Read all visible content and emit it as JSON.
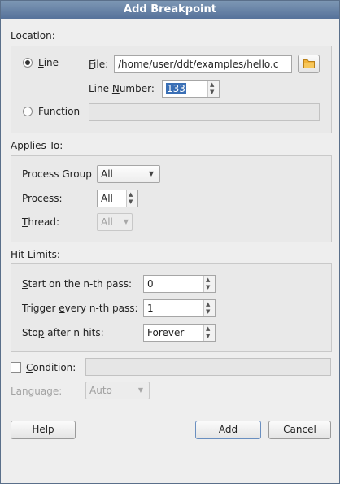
{
  "window": {
    "title": "Add Breakpoint"
  },
  "location": {
    "label": "Location:",
    "line_option": {
      "pre": "",
      "mnemonic": "L",
      "post": "ine",
      "checked": true
    },
    "file": {
      "pre": "",
      "mnemonic": "F",
      "post": "ile:",
      "value": "/home/user/ddt/examples/hello.c"
    },
    "folder_icon": "folder-icon",
    "line_number": {
      "pre": "Line ",
      "mnemonic": "N",
      "post": "umber:",
      "value": "133"
    },
    "function_option": {
      "pre": "F",
      "mnemonic": "u",
      "post": "nction",
      "checked": false,
      "value": ""
    }
  },
  "applies_to": {
    "label": "Applies To:",
    "process_group": {
      "label": "Process Group",
      "value": "All"
    },
    "process": {
      "label": "Process:",
      "value": "All"
    },
    "thread": {
      "pre": "",
      "mnemonic": "T",
      "post": "hread:",
      "value": "All",
      "enabled": false
    }
  },
  "hit_limits": {
    "label": "Hit Limits:",
    "start": {
      "pre": "",
      "mnemonic": "S",
      "post": "tart on the n-th pass:",
      "value": "0"
    },
    "trigger": {
      "pre": "Trigger ",
      "mnemonic": "e",
      "post": "very n-th pass:",
      "value": "1"
    },
    "stop": {
      "pre": "Sto",
      "mnemonic": "p",
      "post": " after n hits:",
      "value": "Forever"
    }
  },
  "condition": {
    "pre": "",
    "mnemonic": "C",
    "post": "ondition:",
    "checked": false,
    "value": "",
    "language_label": "Language:",
    "language_value": "Auto"
  },
  "buttons": {
    "help": "Help",
    "add": {
      "pre": "",
      "mnemonic": "A",
      "post": "dd"
    },
    "cancel": "Cancel"
  },
  "colors": {
    "titlebar": "#56729a",
    "selection": "#3a6fb5",
    "folder": "#e8a21a"
  }
}
